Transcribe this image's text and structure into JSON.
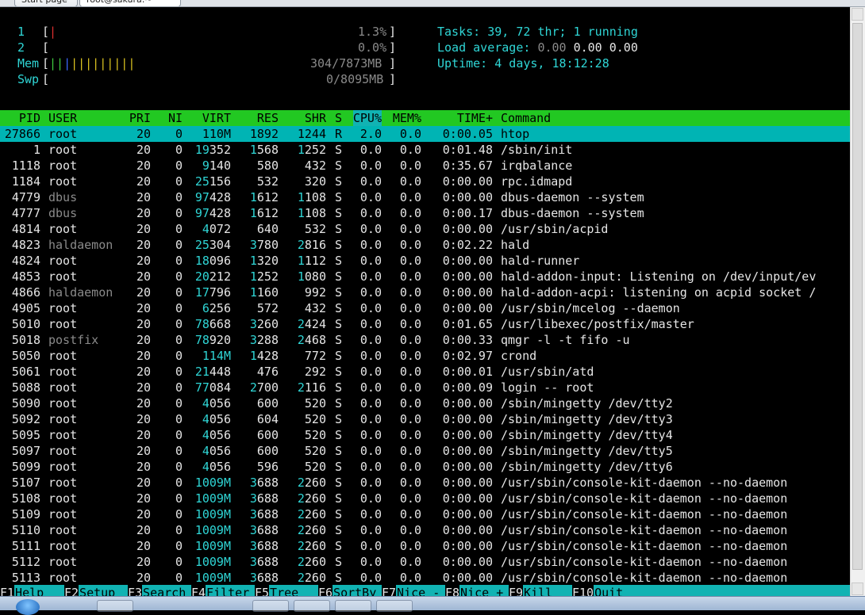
{
  "tabs": [
    "Start page",
    "root@sakura:~"
  ],
  "meters": {
    "cpu1": {
      "label": "1",
      "value": "1.3%"
    },
    "cpu2": {
      "label": "2",
      "value": "0.0%"
    },
    "mem": {
      "label": "Mem",
      "value": "304/7873MB"
    },
    "swp": {
      "label": "Swp",
      "value": "0/8095MB"
    }
  },
  "summary": {
    "tasks_label": "Tasks:",
    "tasks": "39,",
    "threads": "72",
    "thr_label": "thr;",
    "running": "1",
    "running_label": "running",
    "load_label": "Load average:",
    "load1": "0.00",
    "load5": "0.00",
    "load15": "0.00",
    "uptime_label": "Uptime:",
    "uptime": "4 days, 18:12:28"
  },
  "columns": [
    "PID",
    "USER",
    "PRI",
    "NI",
    "VIRT",
    "RES",
    "SHR",
    "S",
    "CPU%",
    "MEM%",
    "TIME+",
    "Command"
  ],
  "processes": [
    [
      "27866",
      "root",
      "20",
      "0",
      "110M",
      "1892",
      "1244",
      "R",
      "2.0",
      "0.0",
      "0:00.05",
      "htop"
    ],
    [
      "1",
      "root",
      "20",
      "0",
      "19352",
      "1568",
      "1252",
      "S",
      "0.0",
      "0.0",
      "0:01.48",
      "/sbin/init"
    ],
    [
      "1118",
      "root",
      "20",
      "0",
      "9140",
      "580",
      "432",
      "S",
      "0.0",
      "0.0",
      "0:35.67",
      "irqbalance"
    ],
    [
      "1184",
      "root",
      "20",
      "0",
      "25156",
      "532",
      "320",
      "S",
      "0.0",
      "0.0",
      "0:00.00",
      "rpc.idmapd"
    ],
    [
      "4779",
      "dbus",
      "20",
      "0",
      "97428",
      "1612",
      "1108",
      "S",
      "0.0",
      "0.0",
      "0:00.00",
      "dbus-daemon --system"
    ],
    [
      "4777",
      "dbus",
      "20",
      "0",
      "97428",
      "1612",
      "1108",
      "S",
      "0.0",
      "0.0",
      "0:00.17",
      "dbus-daemon --system"
    ],
    [
      "4814",
      "root",
      "20",
      "0",
      "4072",
      "640",
      "532",
      "S",
      "0.0",
      "0.0",
      "0:00.00",
      "/usr/sbin/acpid"
    ],
    [
      "4823",
      "haldaemon",
      "20",
      "0",
      "25304",
      "3780",
      "2816",
      "S",
      "0.0",
      "0.0",
      "0:02.22",
      "hald"
    ],
    [
      "4824",
      "root",
      "20",
      "0",
      "18096",
      "1320",
      "1112",
      "S",
      "0.0",
      "0.0",
      "0:00.00",
      "hald-runner"
    ],
    [
      "4853",
      "root",
      "20",
      "0",
      "20212",
      "1252",
      "1080",
      "S",
      "0.0",
      "0.0",
      "0:00.00",
      "hald-addon-input: Listening on /dev/input/ev"
    ],
    [
      "4866",
      "haldaemon",
      "20",
      "0",
      "17796",
      "1160",
      "992",
      "S",
      "0.0",
      "0.0",
      "0:00.00",
      "hald-addon-acpi: listening on acpid socket /"
    ],
    [
      "4905",
      "root",
      "20",
      "0",
      "6256",
      "572",
      "432",
      "S",
      "0.0",
      "0.0",
      "0:00.00",
      "/usr/sbin/mcelog --daemon"
    ],
    [
      "5010",
      "root",
      "20",
      "0",
      "78668",
      "3260",
      "2424",
      "S",
      "0.0",
      "0.0",
      "0:01.65",
      "/usr/libexec/postfix/master"
    ],
    [
      "5018",
      "postfix",
      "20",
      "0",
      "78920",
      "3288",
      "2468",
      "S",
      "0.0",
      "0.0",
      "0:00.33",
      "qmgr -l -t fifo -u"
    ],
    [
      "5050",
      "root",
      "20",
      "0",
      "114M",
      "1428",
      "772",
      "S",
      "0.0",
      "0.0",
      "0:02.97",
      "crond"
    ],
    [
      "5061",
      "root",
      "20",
      "0",
      "21448",
      "476",
      "292",
      "S",
      "0.0",
      "0.0",
      "0:00.01",
      "/usr/sbin/atd"
    ],
    [
      "5088",
      "root",
      "20",
      "0",
      "77084",
      "2700",
      "2116",
      "S",
      "0.0",
      "0.0",
      "0:00.09",
      "login -- root"
    ],
    [
      "5090",
      "root",
      "20",
      "0",
      "4056",
      "600",
      "520",
      "S",
      "0.0",
      "0.0",
      "0:00.00",
      "/sbin/mingetty /dev/tty2"
    ],
    [
      "5092",
      "root",
      "20",
      "0",
      "4056",
      "604",
      "520",
      "S",
      "0.0",
      "0.0",
      "0:00.00",
      "/sbin/mingetty /dev/tty3"
    ],
    [
      "5095",
      "root",
      "20",
      "0",
      "4056",
      "600",
      "520",
      "S",
      "0.0",
      "0.0",
      "0:00.00",
      "/sbin/mingetty /dev/tty4"
    ],
    [
      "5097",
      "root",
      "20",
      "0",
      "4056",
      "600",
      "520",
      "S",
      "0.0",
      "0.0",
      "0:00.00",
      "/sbin/mingetty /dev/tty5"
    ],
    [
      "5099",
      "root",
      "20",
      "0",
      "4056",
      "596",
      "520",
      "S",
      "0.0",
      "0.0",
      "0:00.00",
      "/sbin/mingetty /dev/tty6"
    ],
    [
      "5107",
      "root",
      "20",
      "0",
      "1009M",
      "3688",
      "2260",
      "S",
      "0.0",
      "0.0",
      "0:00.00",
      "/usr/sbin/console-kit-daemon --no-daemon"
    ],
    [
      "5108",
      "root",
      "20",
      "0",
      "1009M",
      "3688",
      "2260",
      "S",
      "0.0",
      "0.0",
      "0:00.00",
      "/usr/sbin/console-kit-daemon --no-daemon"
    ],
    [
      "5109",
      "root",
      "20",
      "0",
      "1009M",
      "3688",
      "2260",
      "S",
      "0.0",
      "0.0",
      "0:00.00",
      "/usr/sbin/console-kit-daemon --no-daemon"
    ],
    [
      "5110",
      "root",
      "20",
      "0",
      "1009M",
      "3688",
      "2260",
      "S",
      "0.0",
      "0.0",
      "0:00.00",
      "/usr/sbin/console-kit-daemon --no-daemon"
    ],
    [
      "5111",
      "root",
      "20",
      "0",
      "1009M",
      "3688",
      "2260",
      "S",
      "0.0",
      "0.0",
      "0:00.00",
      "/usr/sbin/console-kit-daemon --no-daemon"
    ],
    [
      "5112",
      "root",
      "20",
      "0",
      "1009M",
      "3688",
      "2260",
      "S",
      "0.0",
      "0.0",
      "0:00.00",
      "/usr/sbin/console-kit-daemon --no-daemon"
    ],
    [
      "5113",
      "root",
      "20",
      "0",
      "1009M",
      "3688",
      "2260",
      "S",
      "0.0",
      "0.0",
      "0:00.00",
      "/usr/sbin/console-kit-daemon --no-daemon"
    ]
  ],
  "footer": [
    {
      "key": "F1",
      "label": "Help"
    },
    {
      "key": "F2",
      "label": "Setup"
    },
    {
      "key": "F3",
      "label": "Search"
    },
    {
      "key": "F4",
      "label": "Filter"
    },
    {
      "key": "F5",
      "label": "Tree"
    },
    {
      "key": "F6",
      "label": "SortBy"
    },
    {
      "key": "F7",
      "label": "Nice -"
    },
    {
      "key": "F8",
      "label": "Nice +"
    },
    {
      "key": "F9",
      "label": "Kill"
    },
    {
      "key": "F10",
      "label": "Quit"
    }
  ],
  "colors": {
    "header_bg": "#22c822",
    "selected_bg": "#00b4b4",
    "footer_bg": "#11b3b3",
    "cyan_text": "#2fd6d6",
    "gray_text": "#8a8a8a"
  }
}
